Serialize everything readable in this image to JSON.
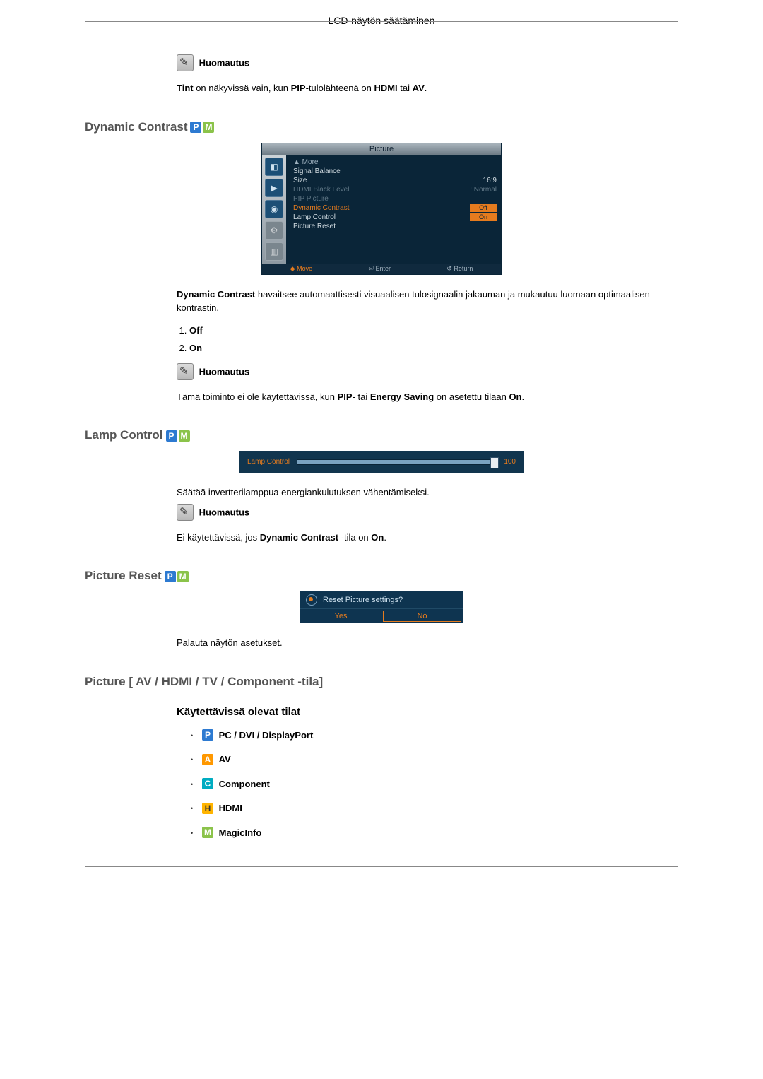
{
  "header": {
    "title": "LCD-näytön säätäminen"
  },
  "note_label": "Huomautus",
  "tint_note": {
    "pre": "Tint",
    "mid": " on näkyvissä vain, kun ",
    "pip": "PIP",
    "mid2": "-tulolähteenä on ",
    "hdmi": "HDMI",
    "or": " tai ",
    "av": "AV",
    "end": "."
  },
  "dc": {
    "heading": "Dynamic Contrast",
    "osd": {
      "title": "Picture",
      "rows": {
        "more": "▲ More",
        "signal": "Signal Balance",
        "size_k": "Size",
        "size_v": "16:9",
        "hdmi_k": "HDMI Black Level",
        "hdmi_v": ": Normal",
        "pip_k": "PIP Picture",
        "dc_k": "Dynamic Contrast",
        "dc_off": "Off",
        "dc_on": "On",
        "lamp": "Lamp Control",
        "reset": "Picture Reset"
      },
      "footer": {
        "move": "Move",
        "enter": "Enter",
        "return": "Return"
      }
    },
    "desc_b": "Dynamic Contrast",
    "desc": " havaitsee automaattisesti visuaalisen tulosignaalin jakauman ja mukautuu luomaan optimaalisen kontrastin.",
    "opt1": "Off",
    "opt2": "On",
    "note_pre": "Tämä toiminto ei ole käytettävissä, kun ",
    "note_pip": "PIP",
    "note_mid": "- tai ",
    "note_es": "Energy Saving",
    "note_mid2": " on asetettu tilaan ",
    "note_on": "On",
    "note_end": "."
  },
  "lamp": {
    "heading": "Lamp Control",
    "osd_label": "Lamp Control",
    "osd_value": "100",
    "desc": "Säätää invertterilamppua energiankulutuksen vähentämiseksi.",
    "note_pre": "Ei käytettävissä, jos ",
    "note_dc": "Dynamic Contrast",
    "note_mid": " -tila on ",
    "note_on": "On",
    "note_end": "."
  },
  "reset": {
    "heading": "Picture Reset",
    "osd_q": "Reset Picture settings?",
    "osd_yes": "Yes",
    "osd_no": "No",
    "desc": "Palauta näytön asetukset."
  },
  "picture_modes": {
    "heading": "Picture [ AV / HDMI / TV / Component -tila]",
    "sub": "Käytettävissä olevat tilat",
    "p_label": " PC / DVI / DisplayPort",
    "a_label": " AV",
    "c_label": " Component",
    "h_label": " HDMI",
    "m_label": " MagicInfo"
  },
  "badges": {
    "P": "P",
    "M": "M",
    "A": "A",
    "C": "C",
    "H": "H"
  }
}
